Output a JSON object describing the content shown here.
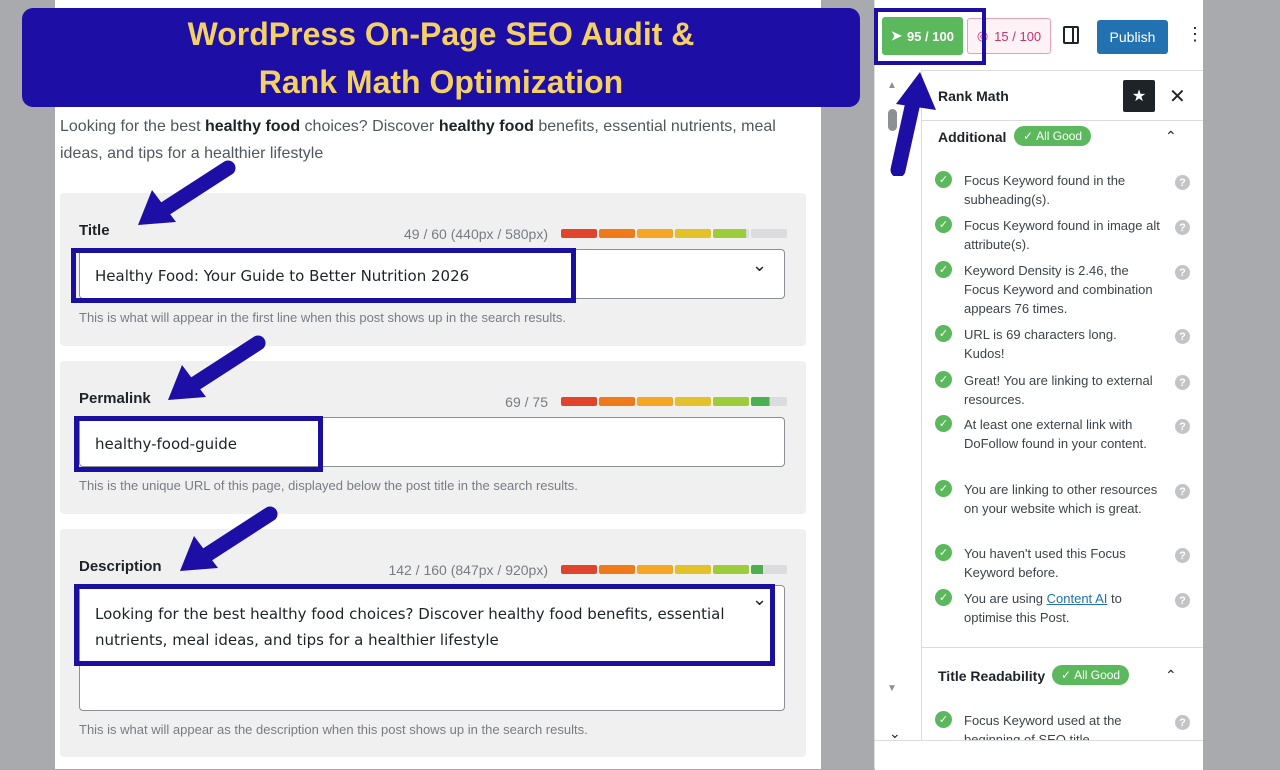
{
  "banner": {
    "line1": "WordPress On-Page SEO Audit &",
    "line2": "Rank Math Optimization"
  },
  "intro": {
    "t1": "Looking for the best ",
    "b1": "healthy food",
    "t2": " choices? Discover ",
    "b2": "healthy food",
    "t3": " benefits, essential nutrients, meal ideas, and tips for a healthier lifestyle"
  },
  "title_field": {
    "label": "Title",
    "count": "49 / 60 (440px / 580px)",
    "value": "Healthy Food: Your Guide to Better Nutrition 2026",
    "help": "This is what will appear in the first line when this post shows up in the search results.",
    "meter_fill": 0.82
  },
  "permalink_field": {
    "label": "Permalink",
    "count": "69 / 75",
    "value": "healthy-food-guide",
    "help": "This is the unique URL of this page, displayed below the post title in the search results.",
    "meter_fill": 0.92
  },
  "description_field": {
    "label": "Description",
    "count": "142 / 160 (847px / 920px)",
    "value": "Looking for the best healthy food choices? Discover healthy food benefits, essential nutrients, meal ideas, and tips for a healthier lifestyle",
    "help": "This is what will appear as the description when this post shows up in the search results.",
    "meter_fill": 0.89
  },
  "toolbar": {
    "seo_score": "95 / 100",
    "readability_score": "15 / 100",
    "publish_label": "Publish"
  },
  "sidebar": {
    "plugin_name": "Rank Math",
    "sections": [
      {
        "title": "Additional",
        "badge": "All Good",
        "items": [
          {
            "text": "Focus Keyword found in the subheading(s)."
          },
          {
            "text": "Focus Keyword found in image alt attribute(s)."
          },
          {
            "text": "Keyword Density is 2.46, the Focus Keyword and combination appears 76 times."
          },
          {
            "text": "URL is 69 characters long. Kudos!"
          },
          {
            "text": "Great! You are linking to external resources."
          },
          {
            "text": "At least one external link with DoFollow found in your content."
          },
          {
            "text": "You are linking to other resources on your website which is great."
          },
          {
            "text": "You haven't used this Focus Keyword before."
          },
          {
            "pre": "You are using ",
            "link": "Content AI",
            "post": " to optimise this Post."
          }
        ]
      },
      {
        "title": "Title Readability",
        "badge": "All Good",
        "items": [
          {
            "text": "Focus Keyword used at the beginning of SEO title."
          }
        ]
      }
    ]
  },
  "colors": {
    "banner_bg": "#1d0fa5",
    "banner_text": "#f5d066",
    "good_green": "#5cb85c",
    "publish_blue": "#2271b1",
    "meter": [
      "#e0452b",
      "#f07a1a",
      "#f5a623",
      "#e2c12a",
      "#9ccc3a",
      "#4caf50"
    ]
  }
}
